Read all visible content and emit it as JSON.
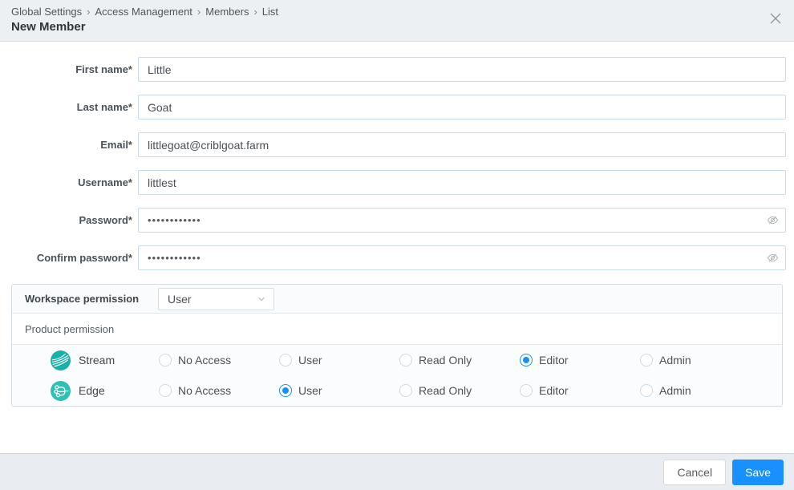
{
  "header": {
    "breadcrumb": [
      "Global Settings",
      "Access Management",
      "Members",
      "List"
    ],
    "separator": "›",
    "title": "New Member"
  },
  "form": {
    "fields": [
      {
        "label": "First name*",
        "value": "Little",
        "type": "text"
      },
      {
        "label": "Last name*",
        "value": "Goat",
        "type": "text"
      },
      {
        "label": "Email*",
        "value": "littlegoat@criblgoat.farm",
        "type": "text"
      },
      {
        "label": "Username*",
        "value": "littlest",
        "type": "text"
      },
      {
        "label": "Password*",
        "value": "••••••••••••",
        "type": "password"
      },
      {
        "label": "Confirm password*",
        "value": "••••••••••••",
        "type": "password"
      }
    ]
  },
  "permissions": {
    "workspace_label": "Workspace permission",
    "workspace_value": "User",
    "product_header": "Product permission",
    "options": [
      "No Access",
      "User",
      "Read Only",
      "Editor",
      "Admin"
    ],
    "products": [
      {
        "name": "Stream",
        "selected": "Editor"
      },
      {
        "name": "Edge",
        "selected": "User"
      }
    ]
  },
  "footer": {
    "cancel_label": "Cancel",
    "save_label": "Save"
  },
  "colors": {
    "accent_blue": "#1890ff",
    "stream_teal": "#16b1a9",
    "edge_teal": "#29c2b5",
    "header_bg": "#edf0f2",
    "footer_bg": "#e9edf1",
    "input_border": "#c7dbe9"
  }
}
